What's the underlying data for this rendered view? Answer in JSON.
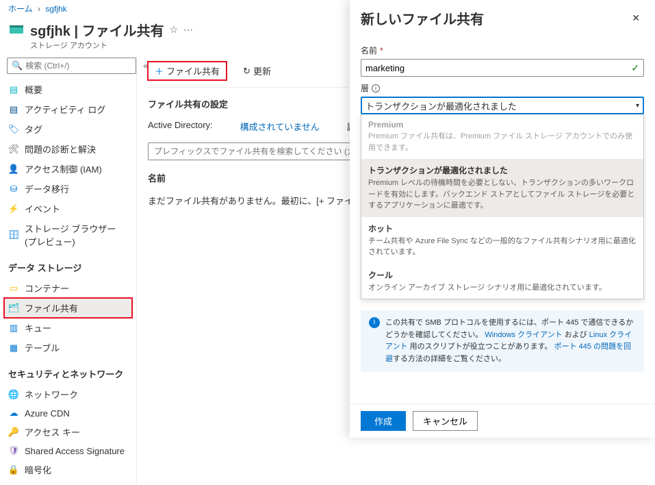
{
  "breadcrumb": {
    "home": "ホーム",
    "current": "sgfjhk"
  },
  "header": {
    "title": "sgfjhk | ファイル共有",
    "subtitle": "ストレージ アカウント"
  },
  "search": {
    "placeholder": "検索 (Ctrl+/)"
  },
  "nav": {
    "top": [
      {
        "label": "概要"
      },
      {
        "label": "アクティビティ ログ"
      },
      {
        "label": "タグ"
      },
      {
        "label": "問題の診断と解決"
      },
      {
        "label": "アクセス制御 (IAM)"
      },
      {
        "label": "データ移行"
      },
      {
        "label": "イベント"
      },
      {
        "label": "ストレージ ブラウザー (プレビュー)"
      }
    ],
    "group_data": "データ ストレージ",
    "data_items": [
      {
        "label": "コンテナー"
      },
      {
        "label": "ファイル共有"
      },
      {
        "label": "キュー"
      },
      {
        "label": "テーブル"
      }
    ],
    "group_sec": "セキュリティとネットワーク",
    "sec_items": [
      {
        "label": "ネットワーク"
      },
      {
        "label": "Azure CDN"
      },
      {
        "label": "アクセス キー"
      },
      {
        "label": "Shared Access Signature"
      },
      {
        "label": "暗号化"
      }
    ]
  },
  "toolbar": {
    "add": "ファイル共有",
    "refresh": "更新"
  },
  "settings_title": "ファイル共有の設定",
  "ad_label": "Active Directory:",
  "ad_value": "構成されていません",
  "softdel_label": "論理的な削除:",
  "filter_placeholder": "プレフィックスでファイル共有を検索してください (大文",
  "col_name": "名前",
  "empty_msg": "まだファイル共有がありません。最初に、[+ ファイル共",
  "panel": {
    "title": "新しいファイル共有",
    "name_label": "名前",
    "name_value": "marketing",
    "tier_label": "層",
    "tier_selected": "トランザクションが最適化されました",
    "options": [
      {
        "title": "Premium",
        "desc": "Premium ファイル共有は、Premium ファイル ストレージ アカウントでのみ使用できます。",
        "disabled": true
      },
      {
        "title": "トランザクションが最適化されました",
        "desc": "Premium レベルの待機時間を必要としない、トランザクションの多いワークロードを有効にします。バックエンド ストアとしてファイル ストレージを必要とするアプリケーションに最適です。",
        "selected": true
      },
      {
        "title": "ホット",
        "desc": "チーム共有や Azure File Sync などの一般的なファイル共有シナリオ用に最適化されています。"
      },
      {
        "title": "クール",
        "desc": "オンライン アーカイブ ストレージ シナリオ用に最適化されています。"
      }
    ],
    "info_pre": "この共有で SMB プロトコルを使用するには、ポート 445 で通信できるかどうかを確認してください。",
    "info_link1": "Windows クライアント",
    "info_mid": " および ",
    "info_link2": "Linux クライアント",
    "info_post": " 用のスクリプトが役立つことがあります。",
    "info_link3": "ポート 445 の問題を回避",
    "info_end": "する方法の詳細をご覧ください。",
    "create": "作成",
    "cancel": "キャンセル"
  }
}
